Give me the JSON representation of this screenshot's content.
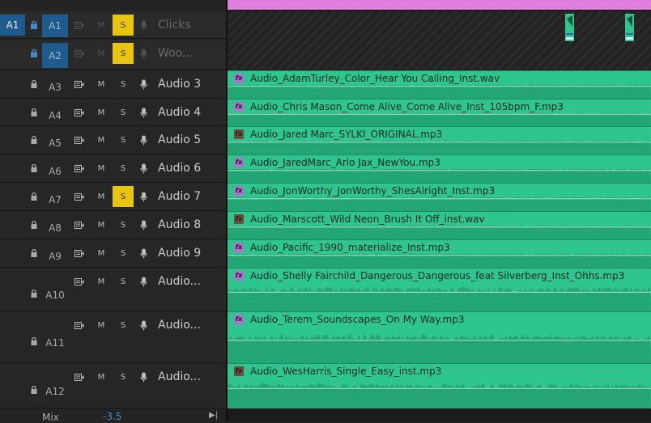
{
  "tracks": [
    {
      "id": "a1",
      "source_patch": "A1",
      "name_label": "A1",
      "label": "Clicks",
      "solo_on": true,
      "locked": true,
      "dimmed": true,
      "name_active": true
    },
    {
      "id": "a2",
      "source_patch": "",
      "name_label": "A2",
      "label": "Woo...",
      "solo_on": true,
      "locked": true,
      "dimmed": true,
      "name_active": true
    },
    {
      "id": "a3",
      "source_patch": "",
      "name_label": "A3",
      "label": "Audio 3",
      "solo_on": false
    },
    {
      "id": "a4",
      "source_patch": "",
      "name_label": "A4",
      "label": "Audio 4",
      "solo_on": false
    },
    {
      "id": "a5",
      "source_patch": "",
      "name_label": "A5",
      "label": "Audio 5",
      "solo_on": false
    },
    {
      "id": "a6",
      "source_patch": "",
      "name_label": "A6",
      "label": "Audio 6",
      "solo_on": false
    },
    {
      "id": "a7",
      "source_patch": "",
      "name_label": "A7",
      "label": "Audio 7",
      "solo_on": true
    },
    {
      "id": "a8",
      "source_patch": "",
      "name_label": "A8",
      "label": "Audio 8",
      "solo_on": false
    },
    {
      "id": "a9",
      "source_patch": "",
      "name_label": "A9",
      "label": "Audio 9",
      "solo_on": false
    },
    {
      "id": "a10",
      "source_patch": "",
      "name_label": "A10",
      "label": "Audio...",
      "solo_on": false
    },
    {
      "id": "a11",
      "source_patch": "",
      "name_label": "A11",
      "label": "Audio...",
      "solo_on": false
    },
    {
      "id": "a12",
      "source_patch": "",
      "name_label": "A12",
      "label": "Audio...",
      "solo_on": false
    }
  ],
  "controls": {
    "mute_label": "M",
    "solo_label": "S"
  },
  "bottom": {
    "mix_label": "Mix",
    "mix_value": "-3.5"
  },
  "clips": [
    {
      "track": "a3",
      "name": "Audio_AdamTurley_Color_Hear You Calling_Inst.wav",
      "fx_active": true
    },
    {
      "track": "a4",
      "name": "Audio_Chris Mason_Come Alive_Come Alive_Inst_105bpm_F.mp3",
      "fx_active": true
    },
    {
      "track": "a5",
      "name": "Audio_Jared Marc_SYLKI_ORIGINAL.mp3",
      "fx_active": false
    },
    {
      "track": "a6",
      "name": "Audio_JaredMarc_Arlo Jax_NewYou.mp3",
      "fx_active": true
    },
    {
      "track": "a7",
      "name": "Audio_JonWorthy_JonWorthy_ShesAlright_Inst.mp3",
      "fx_active": true
    },
    {
      "track": "a8",
      "name": "Audio_Marscott_Wild Neon_Brush It Off_inst.wav",
      "fx_active": false
    },
    {
      "track": "a9",
      "name": "Audio_Pacific_1990_materialize_Inst.mp3",
      "fx_active": true
    },
    {
      "track": "a10",
      "name": "Audio_Shelly Fairchild_Dangerous_Dangerous_feat Silverberg_Inst_Ohhs.mp3",
      "fx_active": true
    },
    {
      "track": "a11",
      "name": "Audio_Terem_Soundscapes_On My Way.mp3",
      "fx_active": true
    },
    {
      "track": "a12",
      "name": "Audio_WesHarris_Single_Easy_inst.mp3",
      "fx_active": false
    }
  ],
  "fx_label": "fx",
  "colors": {
    "clip_fill": "#2ec58f",
    "waveform": "#1c8a5f",
    "solo_on": "#e8c411",
    "source_patch": "#1f5b8c",
    "video_bar": "#df7fe0"
  }
}
